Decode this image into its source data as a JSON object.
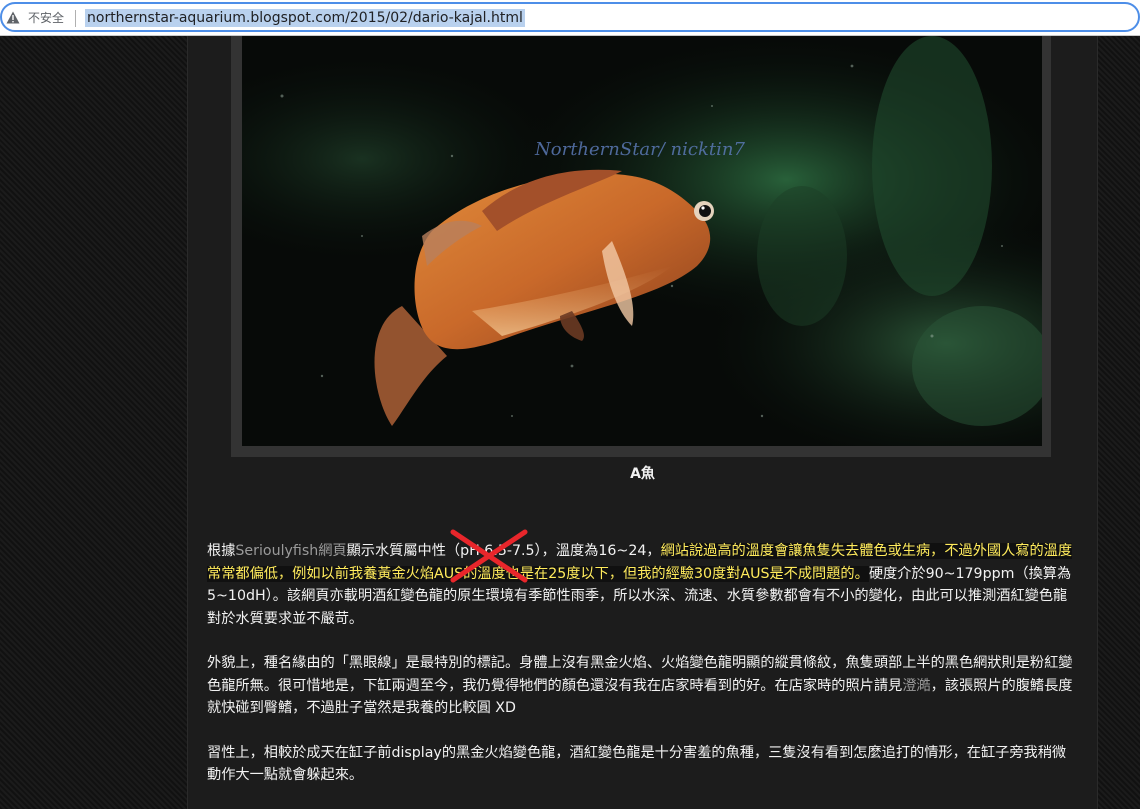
{
  "browser": {
    "security_label": "不安全",
    "url": "northernstar-aquarium.blogspot.com/2015/02/dario-kajal.html"
  },
  "post": {
    "photo": {
      "watermark": "NorthernStar/ nicktin7",
      "caption": "A魚"
    },
    "paragraphs": {
      "p1": {
        "t1": "根據",
        "link1": "Serioulyfish網頁",
        "t2": "顯示水質屬中性（pH 6.5-7.5），溫度為16~24，",
        "highlight": "網站說過高的溫度會讓魚隻失去體色或生病，不過外國人寫的溫度常常都偏低，例如以前我養黃金火焰AUS的溫度也是在25度以下，但我的經驗30度對AUS是不成問題的。",
        "t3": "硬度介於90~179ppm（換算為5~10dH）。該網頁亦載明酒紅變色龍的原生環境有季節性雨季，所以水深、流速、水質參數都會有不小的變化，由此可以推測酒紅變色龍對於水質要求並不嚴苛。"
      },
      "p2": {
        "t1": "外貌上，種名緣由的「黑眼線」是最特別的標記。身體上沒有黑金火焰、火焰變色龍明顯的縱貫條紋，魚隻頭部上半的黑色網狀則是粉紅變色龍所無。很可惜地是，下缸兩週至今，我仍覺得牠們的顏色還沒有我在店家時看到的好。在店家時的照片請見",
        "link1": "澄澔",
        "t2": "，該張照片的腹鰭長度就快碰到臀鰭，不過肚子當然是我養的比較圓 XD"
      },
      "p3": {
        "t1": "習性上，相較於成天在缸子前display的黑金火焰變色龍，酒紅變色龍是十分害羞的魚種，三隻沒有看到怎麼追打的情形，在缸子旁我稍微動作大一點就會躲起來。"
      }
    }
  }
}
